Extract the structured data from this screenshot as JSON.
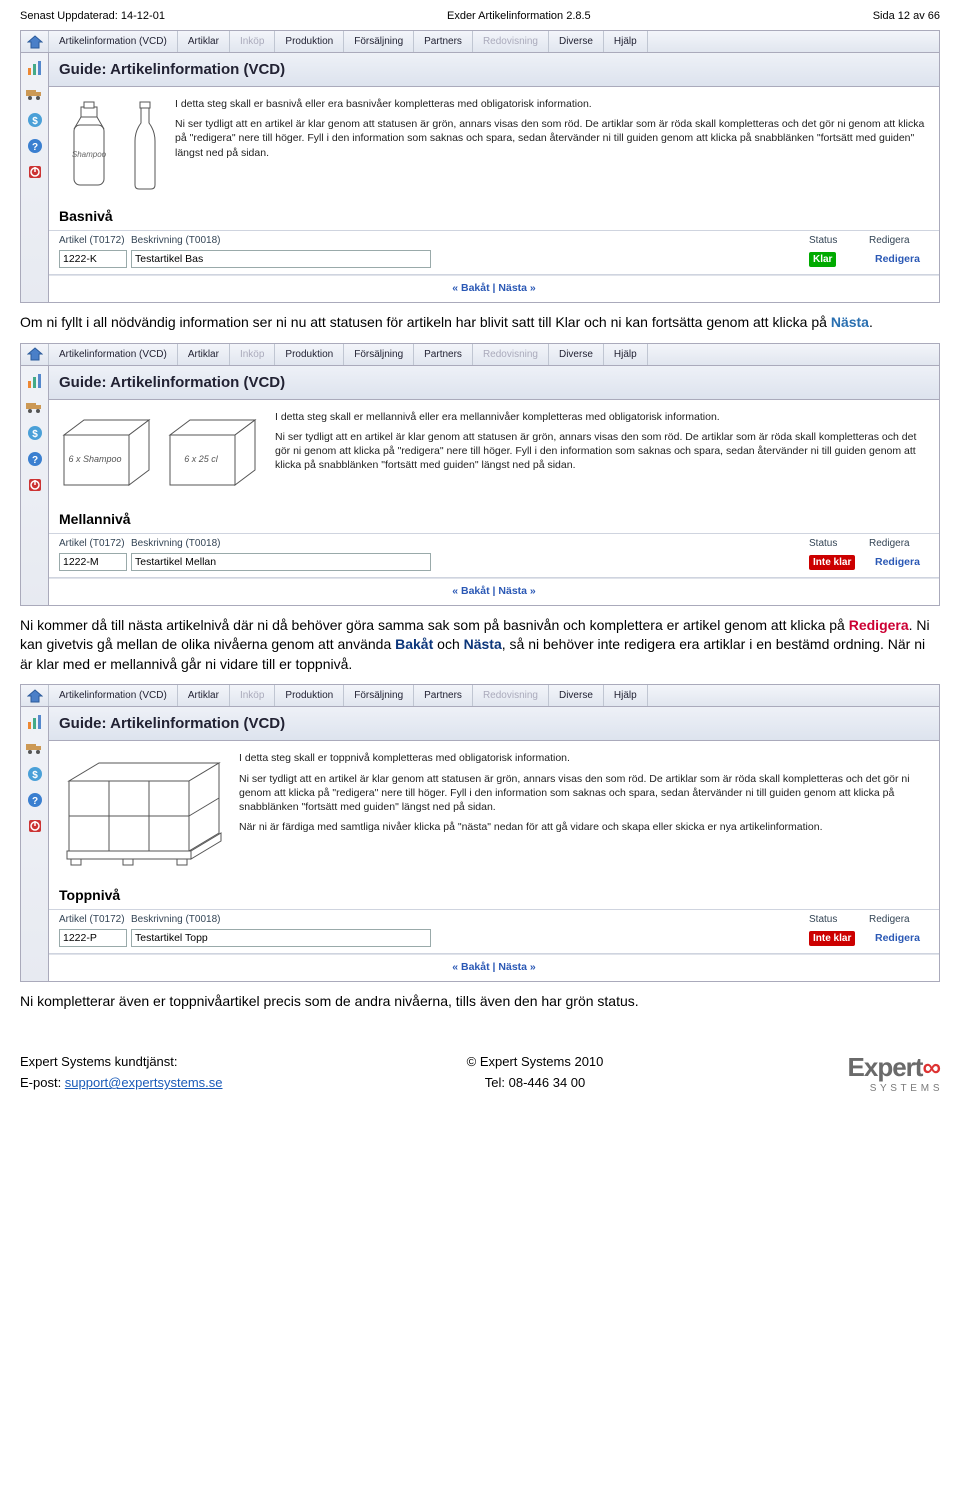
{
  "header": {
    "left": "Senast Uppdaterad: 14-12-01",
    "center": "Exder Artikelinformation 2.8.5",
    "right": "Sida 12 av 66"
  },
  "menu": {
    "items": [
      "Artikelinformation (VCD)",
      "Artiklar",
      "Inköp",
      "Produktion",
      "Försäljning",
      "Partners",
      "Redovisning",
      "Diverse",
      "Hjälp"
    ],
    "dim": [
      2,
      6
    ]
  },
  "sidebar_icons": [
    "chart-icon",
    "truck-icon",
    "dollar-icon",
    "help-icon",
    "power-icon"
  ],
  "guide_title": "Guide: Artikelinformation (VCD)",
  "pager": {
    "back": "« Bakåt",
    "sep": " | ",
    "next": "Nästa »"
  },
  "table_header": {
    "article": "Artikel (T0172)",
    "desc": "Beskrivning (T0018)",
    "status": "Status",
    "edit": "Redigera"
  },
  "status": {
    "klar": "Klar",
    "inte_klar": "Inte klar"
  },
  "edit_label": "Redigera",
  "panels": [
    {
      "info": [
        "I detta steg skall er basnivå eller era basnivåer kompletteras med obligatorisk information.",
        "Ni ser tydligt att en artikel är klar genom att statusen är grön, annars visas den som röd. De artiklar som är röda skall kompletteras och det gör ni genom att klicka på \"redigera\" nere till höger. Fyll i den information som saknas och spara, sedan återvänder ni till guiden genom att klicka på snabblänken \"fortsätt med guiden\" längst ned på sidan."
      ],
      "section": "Basnivå",
      "row": {
        "article": "1222-K",
        "desc": "Testartikel Bas",
        "status_key": "klar",
        "status_class": "status-green"
      },
      "illus": "bottles"
    },
    {
      "info": [
        "I detta steg skall er mellannivå eller era mellannivåer kompletteras med obligatorisk information.",
        "Ni ser tydligt att en artikel är klar genom att statusen är grön, annars visas den som röd. De artiklar som är röda skall kompletteras och det gör ni genom att klicka på \"redigera\" nere till höger. Fyll i den information som saknas och spara, sedan återvänder ni till guiden genom att klicka på snabblänken \"fortsätt med guiden\" längst ned på sidan."
      ],
      "section": "Mellannivå",
      "row": {
        "article": "1222-M",
        "desc": "Testartikel Mellan",
        "status_key": "inte_klar",
        "status_class": "status-red"
      },
      "illus": "boxes",
      "box_labels": {
        "left": "6 x Shampoo",
        "right": "6 x 25 cl"
      }
    },
    {
      "info": [
        "I detta steg skall er toppnivå kompletteras med obligatorisk information.",
        "Ni ser tydligt att en artikel är klar genom att statusen är grön, annars visas den som röd. De artiklar som är röda skall kompletteras och det gör ni genom att klicka på \"redigera\" nere till höger. Fyll i den information som saknas och spara, sedan återvänder ni till guiden genom att klicka på snabblänken \"fortsätt med guiden\" längst ned på sidan.",
        "När ni är färdiga med samtliga nivåer  klicka på \"nästa\" nedan för att gå vidare och skapa eller skicka er nya artikelinformation."
      ],
      "section": "Toppnivå",
      "row": {
        "article": "1222-P",
        "desc": "Testartikel Topp",
        "status_key": "inte_klar",
        "status_class": "status-red"
      },
      "illus": "pallet"
    }
  ],
  "body_texts": [
    {
      "pre": "Om ni fyllt i all nödvändig information ser ni nu att statusen för artikeln har blivit satt till Klar och ni kan fortsätta genom att klicka på ",
      "link": "Nästa",
      "post": "."
    },
    {
      "parts": [
        "Ni kommer då till nästa artikelnivå där ni då behöver göra samma sak som på basnivån och komplettera er artikel genom att klicka på ",
        {
          "cls": "red",
          "t": "Redigera"
        },
        ". Ni kan givetvis gå mellan de olika nivåerna genom att använda ",
        {
          "cls": "blue",
          "t": "Bakåt"
        },
        " och ",
        {
          "cls": "blue",
          "t": "Nästa"
        },
        ", så ni behöver inte redigera era artiklar i en bestämd ordning. När ni är klar med er mellannivå går ni vidare till er toppnivå."
      ]
    },
    {
      "plain": "Ni kompletterar även er toppnivåartikel precis som de andra nivåerna, tills även den har grön status."
    }
  ],
  "footer": {
    "left1": "Expert Systems kundtjänst:",
    "left2_pre": "E-post: ",
    "left2_link": "support@expertsystems.se",
    "mid1": "© Expert Systems 2010",
    "mid2": "Tel: 08-446 34 00",
    "brand": "Expert",
    "sub": "S Y S T E M S"
  }
}
